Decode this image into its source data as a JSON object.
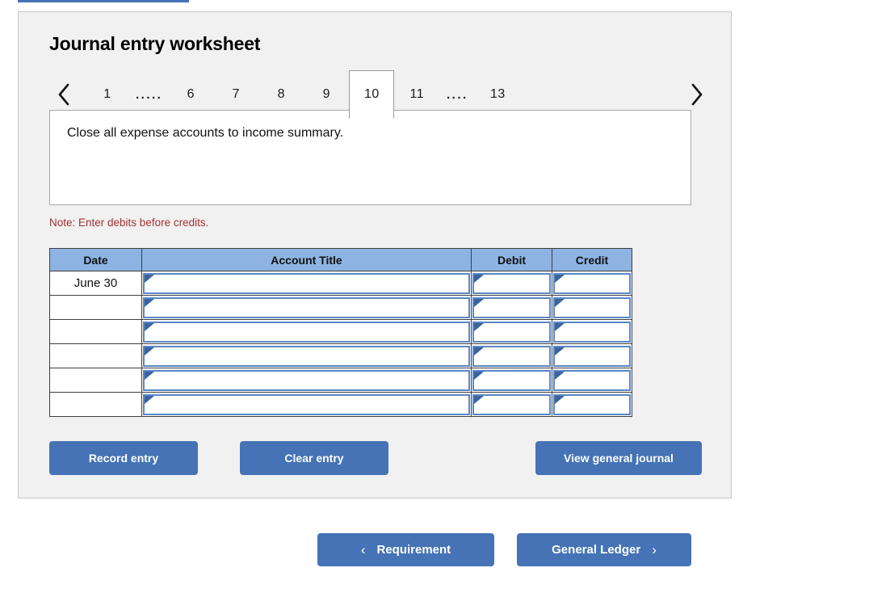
{
  "panel": {
    "title": "Journal entry worksheet",
    "note": "Note: Enter debits before credits.",
    "description": "Close all expense accounts to income summary."
  },
  "tabs": {
    "prev_icon": "chevron-left-icon",
    "next_icon": "chevron-right-icon",
    "active_index": 6,
    "items": [
      {
        "label": "1",
        "type": "page"
      },
      {
        "label": ".....",
        "type": "ellipsis"
      },
      {
        "label": "6",
        "type": "page"
      },
      {
        "label": "7",
        "type": "page"
      },
      {
        "label": "8",
        "type": "page"
      },
      {
        "label": "9",
        "type": "page"
      },
      {
        "label": "10",
        "type": "page"
      },
      {
        "label": "11",
        "type": "page"
      },
      {
        "label": "....",
        "type": "ellipsis"
      },
      {
        "label": "13",
        "type": "page"
      }
    ]
  },
  "table": {
    "columns": [
      "Date",
      "Account Title",
      "Debit",
      "Credit"
    ],
    "rows": [
      {
        "date": "June 30",
        "account": "",
        "debit": "",
        "credit": ""
      },
      {
        "date": "",
        "account": "",
        "debit": "",
        "credit": ""
      },
      {
        "date": "",
        "account": "",
        "debit": "",
        "credit": ""
      },
      {
        "date": "",
        "account": "",
        "debit": "",
        "credit": ""
      },
      {
        "date": "",
        "account": "",
        "debit": "",
        "credit": ""
      },
      {
        "date": "",
        "account": "",
        "debit": "",
        "credit": ""
      }
    ]
  },
  "actions": {
    "record_entry": "Record entry",
    "clear_entry": "Clear entry",
    "view_general_journal": "View general journal"
  },
  "footer": {
    "requirement": "Requirement",
    "requirement_icon": "chevron-left-icon",
    "general_ledger": "General Ledger",
    "general_ledger_icon": "chevron-right-icon"
  },
  "colors": {
    "panel_bg": "#f1f1f1",
    "header_blue": "#8db3e2",
    "button_blue": "#4573b5",
    "field_border": "#5b87c5",
    "note_red": "#a33131"
  }
}
